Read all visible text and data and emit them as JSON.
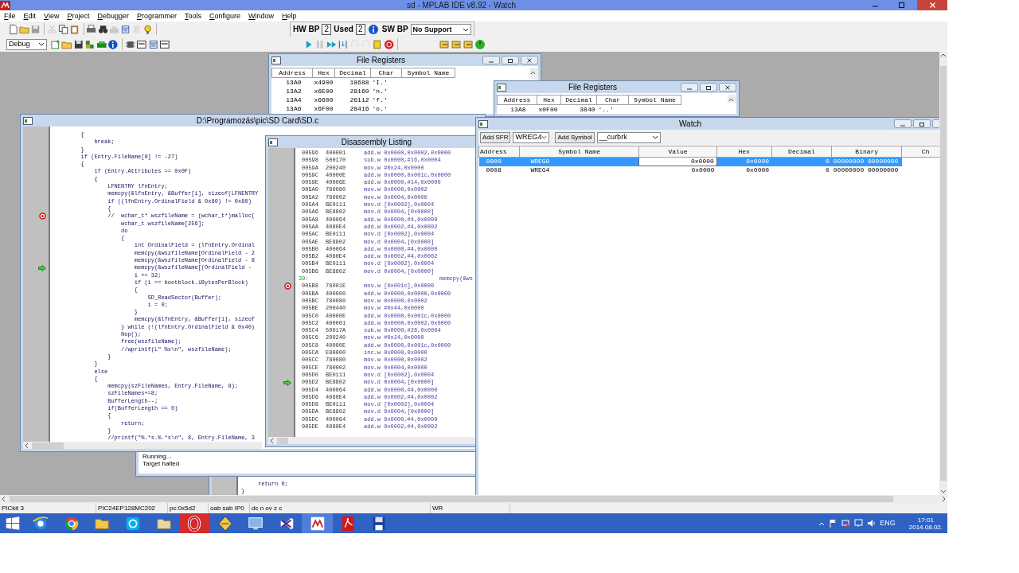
{
  "window": {
    "title": "sd - MPLAB IDE v8.92 - Watch"
  },
  "menu": [
    "File",
    "Edit",
    "View",
    "Project",
    "Debugger",
    "Programmer",
    "Tools",
    "Configure",
    "Window",
    "Help"
  ],
  "toolbar": {
    "configuration": "Debug",
    "hw_bp_label": "HW BP",
    "hw_bp_count": "2",
    "used_label": "Used",
    "sw_bp_count": "2",
    "sw_bp_label": "SW BP",
    "sw_bp_support": "No Support"
  },
  "file_registers": [
    {
      "title": "File Registers",
      "columns": [
        "Address",
        "Hex",
        "Decimal",
        "Char",
        "Symbol Name"
      ],
      "rows": [
        [
          "13A0",
          "x4900",
          "18688",
          "'I.'"
        ],
        [
          "13A2",
          "x6E00",
          "28160",
          "'n.'"
        ],
        [
          "13A4",
          "x6600",
          "26112",
          "'f.'"
        ],
        [
          "13A6",
          "x6F00",
          "28416",
          "'o.'"
        ]
      ]
    },
    {
      "title": "File Registers",
      "columns": [
        "Address",
        "Hex",
        "Decimal",
        "Char",
        "Symbol Name"
      ],
      "rows": [
        [
          "13A8",
          "x0F00",
          "3840",
          "'..'"
        ]
      ]
    }
  ],
  "source_window": {
    "title": "D:\\Programozás\\pic\\SD Card\\SD.c",
    "lines": [
      "        {",
      "            break;",
      "        }",
      "        if (Entry.FileName[0] != -27)",
      "        {",
      "            if (Entry.Attributes == 0x0F)",
      "            {",
      "                LFNENTRY lfnEntry;",
      "                memcpy(&lfnEntry, &Buffer[i], sizeof(LFNENTRY",
      "                if ((lfnEntry.OrdinalField & 0x80) != 0x80)",
      "                {",
      {
        "text": "                //  wchar_t* wszfileName = (wchar_t*)malloc(",
        "breakpoint": true
      },
      "                    wchar_t wszfileName[256];",
      "                    do",
      "                    {",
      "                        int OrdinalField = (lfnEntry.Ordinal",
      "                        memcpy(&wszfileName[OrdinalField - 2",
      "                        memcpy(&wszfileName[OrdinalField - 8",
      {
        "text": "                        memcpy(&wszfileName[(OrdinalField -",
        "current": true
      },
      "                        i += 32;",
      "                        if (i == bootblock.iBytesPerBlock)",
      "                        {",
      "                            SD_ReadSector(Buffer);",
      "                            i = 0;",
      "                        }",
      "                        memcpy(&lfnEntry, &Buffer[i], sizeof",
      "                    } while (!(lfnEntry.OrdinalField & 0x40)",
      "                    Nop();",
      "                    free(wszfileName);",
      "                    //wprintf(L\" %s\\n\", wszfileName);",
      "                }",
      "            }",
      "            else",
      "            {",
      "                memcpy(szFileNames, Entry.FileName, 8);",
      "                szFileNames+=8;",
      "                BufferLength--;",
      "                if(BufferLength == 0)",
      "                {",
      "                    return;",
      "                }",
      "                //printf(\"%.*s.%.*s\\n\", 8, Entry.FileName, 3"
    ]
  },
  "disassembly": {
    "title": "Disassembly Listing",
    "lines": [
      {
        "kind": "instruction",
        "address": "00596",
        "opcode": "400001",
        "instruction": "add.w 0x0000,0x0002,0x0000"
      },
      {
        "kind": "instruction",
        "address": "00598",
        "opcode": "500170",
        "instruction": "sub.w 0x0000,#16,0x0004"
      },
      {
        "kind": "instruction",
        "address": "0059A",
        "opcode": "200240",
        "instruction": "mov.w #0x24,0x0000"
      },
      {
        "kind": "instruction",
        "address": "0059C",
        "opcode": "40000E",
        "instruction": "add.w 0x0000,0x001c,0x0000"
      },
      {
        "kind": "instruction",
        "address": "0059E",
        "opcode": "40006E",
        "instruction": "add.w 0x0000,#14,0x0000"
      },
      {
        "kind": "instruction",
        "address": "005A0",
        "opcode": "780080",
        "instruction": "mov.w 0x0000,0x0002"
      },
      {
        "kind": "instruction",
        "address": "005A2",
        "opcode": "780002",
        "instruction": "mov.w 0x0004,0x0000"
      },
      {
        "kind": "instruction",
        "address": "005A4",
        "opcode": "BE0111",
        "instruction": "mov.d [0x0002],0x0004"
      },
      {
        "kind": "instruction",
        "address": "005A6",
        "opcode": "BE8802",
        "instruction": "mov.d 0x0004,[0x0000]"
      },
      {
        "kind": "instruction",
        "address": "005A8",
        "opcode": "400064",
        "instruction": "add.w 0x0000,#4,0x0000"
      },
      {
        "kind": "instruction",
        "address": "005AA",
        "opcode": "4080E4",
        "instruction": "add.w 0x0002,#4,0x0002"
      },
      {
        "kind": "instruction",
        "address": "005AC",
        "opcode": "BE0111",
        "instruction": "mov.d [0x0002],0x0004"
      },
      {
        "kind": "instruction",
        "address": "005AE",
        "opcode": "BE8802",
        "instruction": "mov.d 0x0004,[0x0000]"
      },
      {
        "kind": "instruction",
        "address": "005B0",
        "opcode": "400064",
        "instruction": "add.w 0x0000,#4,0x0000"
      },
      {
        "kind": "instruction",
        "address": "005B2",
        "opcode": "4080E4",
        "instruction": "add.w 0x0002,#4,0x0002"
      },
      {
        "kind": "instruction",
        "address": "005B4",
        "opcode": "BE0111",
        "instruction": "mov.d [0x0002],0x0004"
      },
      {
        "kind": "instruction",
        "address": "005B6",
        "opcode": "BE8802",
        "instruction": "mov.d 0x0004,[0x0000]"
      },
      {
        "kind": "source",
        "line": "39:",
        "text": "memcpy(&ws"
      },
      {
        "kind": "instruction",
        "address": "005B8",
        "opcode": "78001E",
        "instruction": "mov.w [0x001c],0x0000",
        "breakpoint": true
      },
      {
        "kind": "instruction",
        "address": "005BA",
        "opcode": "400000",
        "instruction": "add.w 0x0000,0x0000,0x0000"
      },
      {
        "kind": "instruction",
        "address": "005BC",
        "opcode": "780080",
        "instruction": "mov.w 0x0000,0x0002"
      },
      {
        "kind": "instruction",
        "address": "005BE",
        "opcode": "200440",
        "instruction": "mov.w #0x44,0x0000"
      },
      {
        "kind": "instruction",
        "address": "005C0",
        "opcode": "40000E",
        "instruction": "add.w 0x0000,0x001c,0x0000"
      },
      {
        "kind": "instruction",
        "address": "005C2",
        "opcode": "400001",
        "instruction": "add.w 0x0000,0x0002,0x0000"
      },
      {
        "kind": "instruction",
        "address": "005C4",
        "opcode": "50017A",
        "instruction": "sub.w 0x0000,#26,0x0004"
      },
      {
        "kind": "instruction",
        "address": "005C6",
        "opcode": "200240",
        "instruction": "mov.w #0x24,0x0000"
      },
      {
        "kind": "instruction",
        "address": "005C8",
        "opcode": "40000E",
        "instruction": "add.w 0x0000,0x001c,0x0000"
      },
      {
        "kind": "instruction",
        "address": "005CA",
        "opcode": "E80000",
        "instruction": "inc.w 0x0000,0x0000"
      },
      {
        "kind": "instruction",
        "address": "005CC",
        "opcode": "780080",
        "instruction": "mov.w 0x0000,0x0002"
      },
      {
        "kind": "instruction",
        "address": "005CE",
        "opcode": "780002",
        "instruction": "mov.w 0x0004,0x0000"
      },
      {
        "kind": "instruction",
        "address": "005D0",
        "opcode": "BE0111",
        "instruction": "mov.d [0x0002],0x0004"
      },
      {
        "kind": "instruction",
        "address": "005D2",
        "opcode": "BE8802",
        "instruction": "mov.d 0x0004,[0x0000]",
        "current": true
      },
      {
        "kind": "instruction",
        "address": "005D4",
        "opcode": "400064",
        "instruction": "add.w 0x0000,#4,0x0000"
      },
      {
        "kind": "instruction",
        "address": "005D6",
        "opcode": "4080E4",
        "instruction": "add.w 0x0002,#4,0x0002"
      },
      {
        "kind": "instruction",
        "address": "005D8",
        "opcode": "BE0111",
        "instruction": "mov.d [0x0002],0x0004"
      },
      {
        "kind": "instruction",
        "address": "005DA",
        "opcode": "BE8802",
        "instruction": "mov.d 0x0004,[0x0000]"
      },
      {
        "kind": "instruction",
        "address": "005DC",
        "opcode": "400064",
        "instruction": "add.w 0x0000,#4,0x0000"
      },
      {
        "kind": "instruction",
        "address": "005DE",
        "opcode": "4080E4",
        "instruction": "add.w 0x0002,#4,0x0002"
      }
    ]
  },
  "output_window": {
    "lines": [
      "Running...",
      "Target halted"
    ]
  },
  "source_window_2": {
    "lines": [
      "     return 0;",
      "}"
    ]
  },
  "watch": {
    "title": "Watch",
    "add_sfr": "Add SFR",
    "sfr": "WREG4",
    "add_symbol": "Add Symbol",
    "symbol": "__curbrk",
    "columns": [
      "Address",
      "Symbol Name",
      "Value",
      "Hex",
      "Decimal",
      "Binary",
      "Ch"
    ],
    "rows": [
      {
        "selected": true,
        "cells": [
          "0000",
          "WREG0",
          "0x0000",
          "0x0000",
          "0",
          "00000000 00000000"
        ]
      },
      {
        "selected": false,
        "cells": [
          "0008",
          "WREG4",
          "0x0000",
          "0x0000",
          "0",
          "00000000 00000000"
        ]
      }
    ]
  },
  "status_bar": [
    "PICkit 3",
    "PIC24EP128MC202",
    "pc:0x5d2",
    "oab sab IP0",
    "dc n ov z c",
    "WR"
  ],
  "taskbar": {
    "language": "ENG",
    "time": "17:01",
    "date": "2014.08.02."
  }
}
